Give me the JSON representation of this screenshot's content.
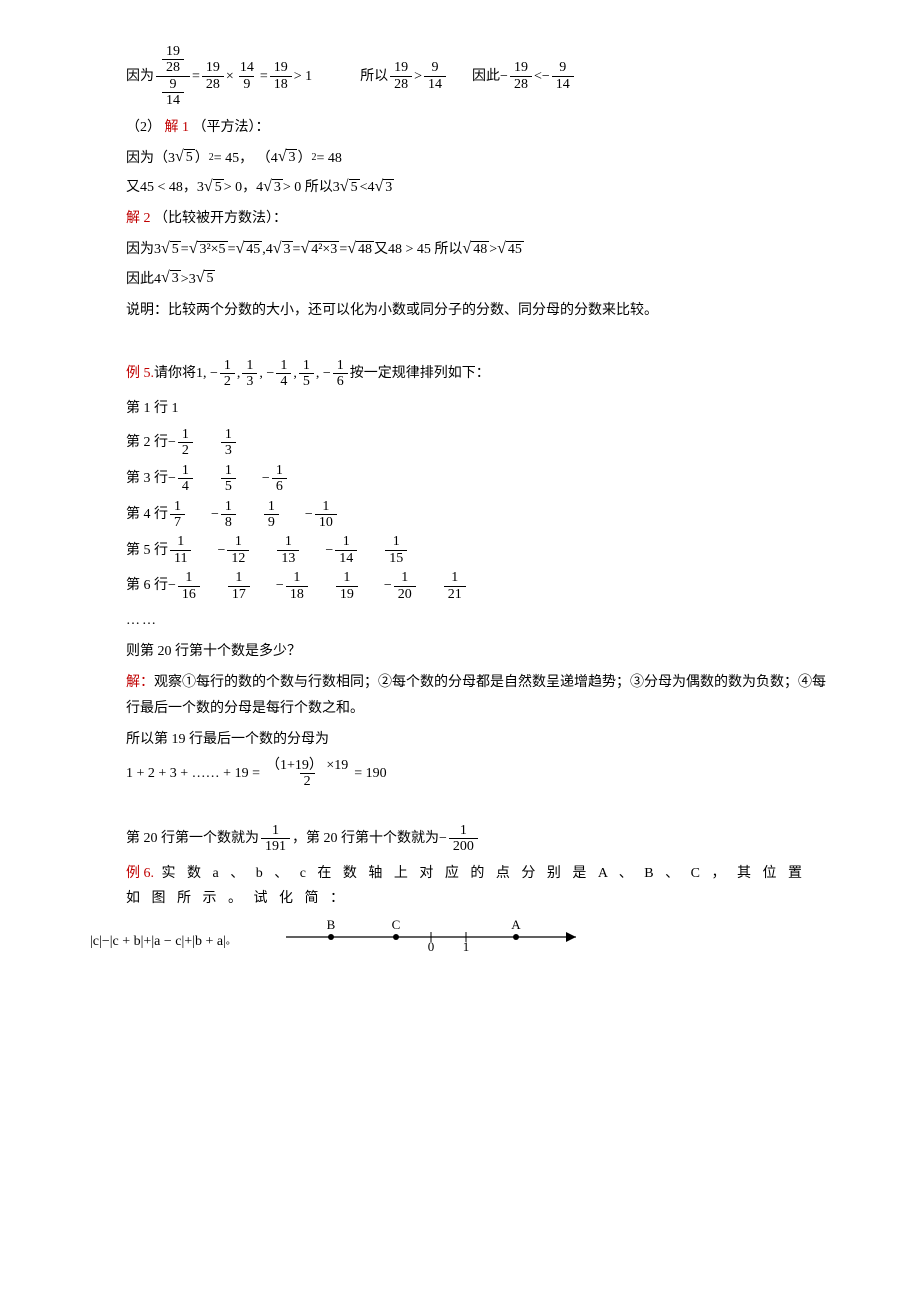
{
  "l1_pre": "因为",
  "l1_eq1": "=",
  "l1_times": "×",
  "l1_eq2": "=",
  "l1_gt1": "> 1",
  "l1_so": "所以",
  "l1_cmp1": ">",
  "l1_thus": "因此",
  "l1_neg": "−",
  "l1_cmp2": "<",
  "f19": "19",
  "f28": "28",
  "f9": "9",
  "f14": "14",
  "f18": "18",
  "l2_num": "（2）",
  "l2_sol1": "解 1",
  "l2_sol1_suffix": "（平方法）：",
  "l3_pre": "因为（",
  "l3_a": "3",
  "l3_r5": "5",
  "l3_close": "）",
  "l3_sq": "2",
  "l3_eq45": "= 45，  （",
  "l3_b": "4",
  "l3_r3": "3",
  "l3_eq48": "= 48",
  "l4_pre": "又45 < 48，",
  "l4_a": "3",
  "l4_gt0a": " > 0，",
  "l4_b": "4",
  "l4_gt0b": " > 0 所以",
  "l4_lt": " < ",
  "l5_sol2": "解 2",
  "l5_sol2_suffix": "（比较被开方数法）：",
  "l6_pre": "因为",
  "l6_eq": "=",
  "l6_325": "3²×5",
  "l6_45": "45",
  "l6_comma": ",  ",
  "l6_423": "4²×3",
  "l6_48": "48",
  "l6_tail": " 又48 > 45 所以",
  "l6_gt": " > ",
  "l7_pre": "因此",
  "l7_gt": " > ",
  "l8": "说明：比较两个分数的大小，还可以化为小数或同分子的分数、同分母的分数来比较。",
  "ex5_label": "例 5.",
  "ex5_pre": " 请你将 ",
  "ex5_seq_1": "1,   −",
  "ex5_f12n": "1",
  "ex5_f12d": "2",
  "ex5_c1": ",   ",
  "ex5_f13n": "1",
  "ex5_f13d": "3",
  "ex5_c2": ",   −",
  "ex5_f14n": "1",
  "ex5_f14d": "4",
  "ex5_c3": ",   ",
  "ex5_f15n": "1",
  "ex5_f15d": "5",
  "ex5_c4": ",   −",
  "ex5_f16n": "1",
  "ex5_f16d": "6",
  "ex5_suffix": " 按一定规律排列如下：",
  "row1_label": "第 1 行 1",
  "row2_label": "第 2 行 ",
  "row3_label": "第 3 行 ",
  "row4_label": "第 4 行 ",
  "row5_label": "第 5 行 ",
  "row6_label": "第 6 行 ",
  "neg": "−",
  "n1": "1",
  "d2": "2",
  "d3": "3",
  "d4": "4",
  "d5": "5",
  "d6": "6",
  "d7": "7",
  "d8": "8",
  "d9": "9",
  "d10": "10",
  "d11": "11",
  "d12": "12",
  "d13": "13",
  "d14": "14",
  "d15": "15",
  "d16": "16",
  "d17": "17",
  "d18": "18",
  "d19": "19",
  "d20": "20",
  "d21": "21",
  "ellipsis": "……",
  "q20": "则第 20 行第十个数是多少？",
  "sol_label": "解：",
  "obs": "观察①每行的数的个数与行数相同；②每个数的分母都是自然数呈递增趋势；③分母为偶数的数为负数；④每行最后一个数的分母是每行个数之和。",
  "so19": "所以第 19 行最后一个数的分母为",
  "sum_lhs": "1 + 2 + 3 + …… + 19 = ",
  "sum_num": "（1+19） ×19",
  "sum_den": "2",
  "sum_eq": " = 190",
  "r20_pre": "第 20 行第一个数就为 ",
  "r20_f1n": "1",
  "r20_f1d": "191",
  "r20_mid": " ，第 20 行第十个数就为 ",
  "r20_neg": "−",
  "r20_f2n": "1",
  "r20_f2d": "200",
  "ex6_label": "例 6.",
  "ex6_text": " 实 数 a 、 b 、 c 在 数 轴 上 对 应 的 点 分 别 是 A 、 B 、 C ， 其 位 置 如 图 所 示 。 试 化 简 ：",
  "ex6_expr": "|c|−|c + b|+|a − c|+|b + a|",
  "ex6_period": "。",
  "nl_B": "B",
  "nl_C": "C",
  "nl_0": "0",
  "nl_1": "1",
  "nl_A": "A"
}
